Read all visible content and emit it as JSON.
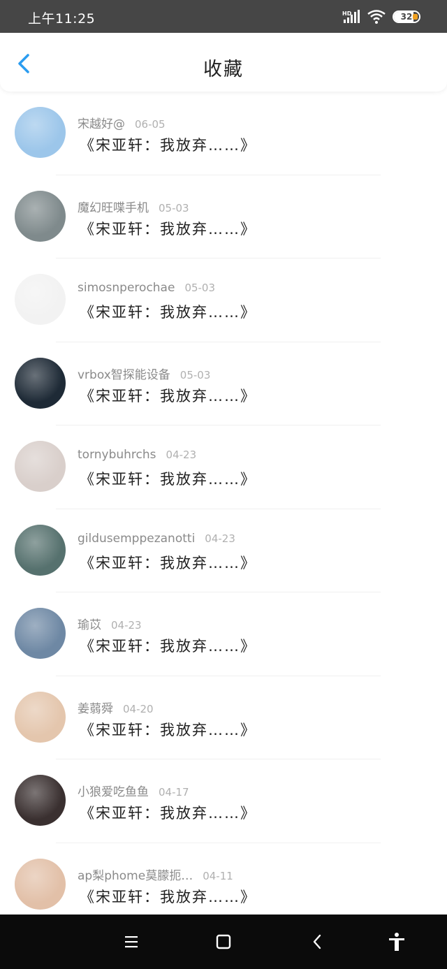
{
  "status_bar": {
    "time": "上午11:25",
    "battery": "32",
    "icons": [
      "hd-signal-icon",
      "wifi-icon",
      "battery-icon"
    ]
  },
  "header": {
    "title": "收藏",
    "back_icon": "chevron-left-icon",
    "accent_color": "#2a9cf0"
  },
  "favorites": [
    {
      "name": "宋越好@",
      "date": "06-05",
      "title": "《宋亚轩：我放弃……》",
      "avatar_color": "#9cc6ea"
    },
    {
      "name": "魔幻旺喋手机",
      "date": "05-03",
      "title": "《宋亚轩：我放弃……》",
      "avatar_color": "#7f8a8c"
    },
    {
      "name": "simosnperochae",
      "date": "05-03",
      "title": "《宋亚轩：我放弃……》",
      "avatar_color": "#f2f2f2"
    },
    {
      "name": "vrbox智探能设备",
      "date": "05-03",
      "title": "《宋亚轩：我放弃……》",
      "avatar_color": "#1e2a36"
    },
    {
      "name": "tornybuhrchs",
      "date": "04-23",
      "title": "《宋亚轩：我放弃……》",
      "avatar_color": "#d9cfcb"
    },
    {
      "name": "gildusemppezanotti",
      "date": "04-23",
      "title": "《宋亚轩：我放弃……》",
      "avatar_color": "#56716e"
    },
    {
      "name": "瑜苡",
      "date": "04-23",
      "title": "《宋亚轩：我放弃……》",
      "avatar_color": "#6e88a4"
    },
    {
      "name": "姜蒻舜",
      "date": "04-20",
      "title": "《宋亚轩：我放弃……》",
      "avatar_color": "#e4c6ad"
    },
    {
      "name": "小狼爱吃鱼鱼",
      "date": "04-17",
      "title": "《宋亚轩：我放弃……》",
      "avatar_color": "#3a3030"
    },
    {
      "name": "ap梨phome莫朦扼…",
      "date": "04-11",
      "title": "《宋亚轩：我放弃……》",
      "avatar_color": "#e2c0a8"
    }
  ],
  "nav_bar": {
    "icons": [
      "menu-icon",
      "home-icon",
      "back-icon",
      "accessibility-icon"
    ]
  }
}
